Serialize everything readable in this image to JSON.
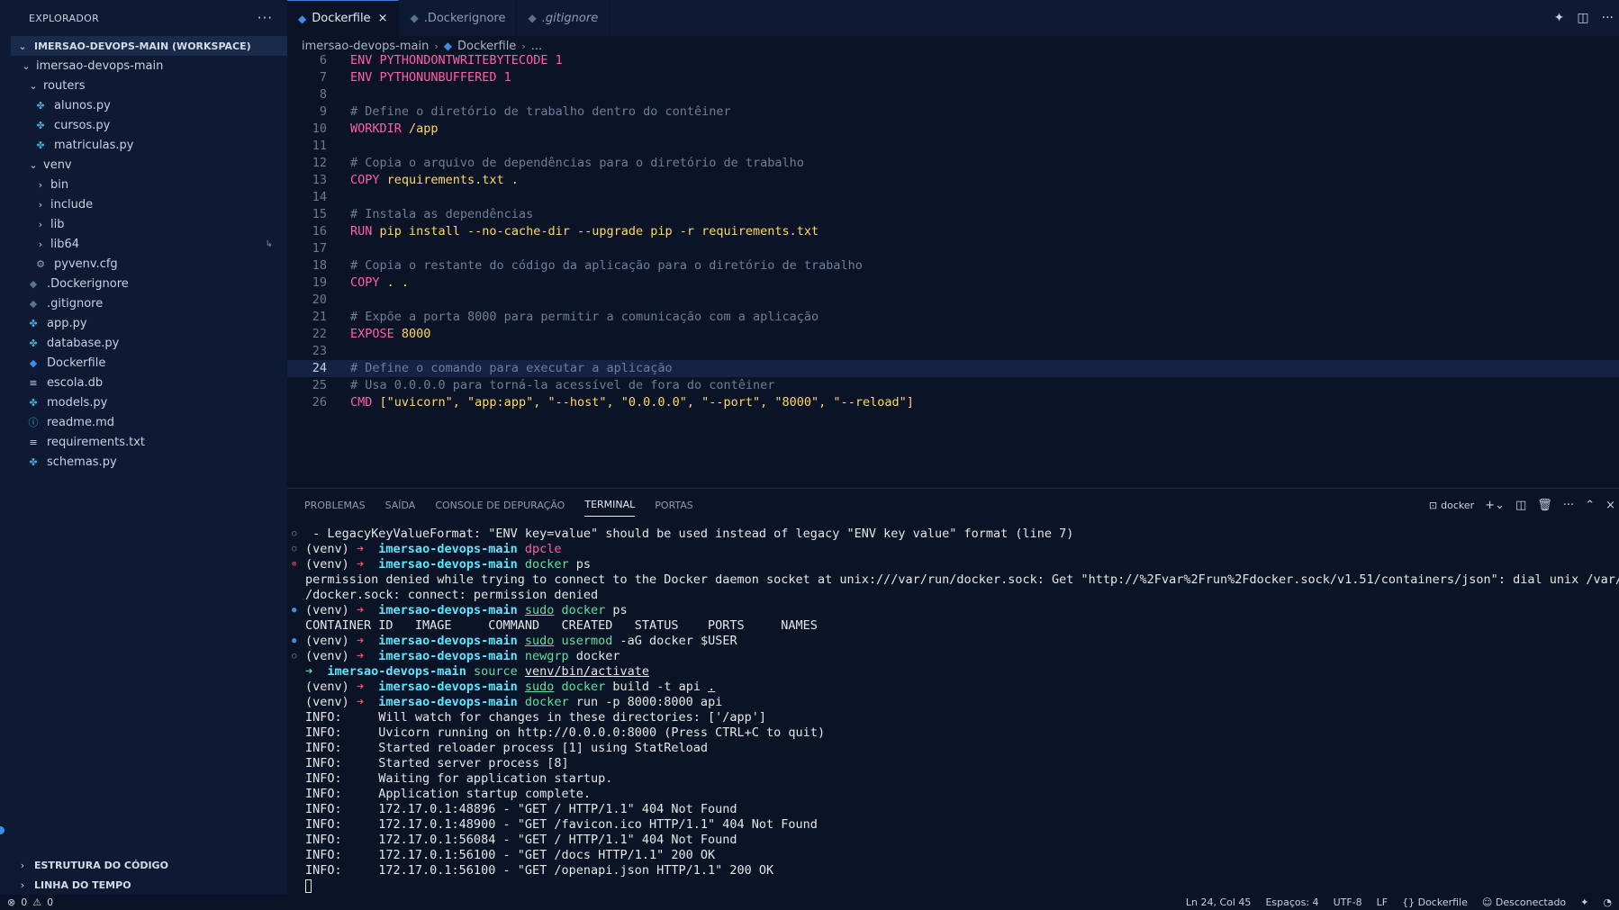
{
  "sidebar": {
    "title": "EXPLORADOR",
    "more": "···",
    "workspace": "IMERSAO-DEVOPS-MAIN (WORKSPACE)",
    "tree": [
      {
        "label": "imersao-devops-main",
        "chev": "⌄",
        "icon": "",
        "indent": 1,
        "color": "#c8d0e0"
      },
      {
        "label": "routers",
        "chev": "⌄",
        "icon": "",
        "indent": 2,
        "color": "#c8d0e0"
      },
      {
        "label": "alunos.py",
        "chev": "",
        "icon": "✤",
        "indent": 3,
        "color": "#4aa8d8"
      },
      {
        "label": "cursos.py",
        "chev": "",
        "icon": "✤",
        "indent": 3,
        "color": "#4aa8d8"
      },
      {
        "label": "matriculas.py",
        "chev": "",
        "icon": "✤",
        "indent": 3,
        "color": "#4aa8d8"
      },
      {
        "label": "venv",
        "chev": "⌄",
        "icon": "",
        "indent": 2,
        "color": "#c8d0e0"
      },
      {
        "label": "bin",
        "chev": "›",
        "icon": "",
        "indent": 3,
        "color": "#c8d0e0"
      },
      {
        "label": "include",
        "chev": "›",
        "icon": "",
        "indent": 3,
        "color": "#c8d0e0"
      },
      {
        "label": "lib",
        "chev": "›",
        "icon": "",
        "indent": 3,
        "color": "#c8d0e0"
      },
      {
        "label": "lib64",
        "chev": "›",
        "icon": "",
        "indent": 3,
        "color": "#c8d0e0",
        "badge": "↳"
      },
      {
        "label": "pyvenv.cfg",
        "chev": "",
        "icon": "⚙",
        "indent": 3,
        "color": "#9aa5b8"
      },
      {
        "label": ".Dockerignore",
        "chev": "",
        "icon": "◆",
        "indent": 2,
        "color": "#5b6f8f"
      },
      {
        "label": ".gitignore",
        "chev": "",
        "icon": "◆",
        "indent": 2,
        "color": "#5b6f8f"
      },
      {
        "label": "app.py",
        "chev": "",
        "icon": "✤",
        "indent": 2,
        "color": "#4aa8d8"
      },
      {
        "label": "database.py",
        "chev": "",
        "icon": "✤",
        "indent": 2,
        "color": "#4aa8d8"
      },
      {
        "label": "Dockerfile",
        "chev": "",
        "icon": "◆",
        "indent": 2,
        "color": "#3a8ee6"
      },
      {
        "label": "escola.db",
        "chev": "",
        "icon": "≡",
        "indent": 2,
        "color": "#c8d0e0"
      },
      {
        "label": "models.py",
        "chev": "",
        "icon": "✤",
        "indent": 2,
        "color": "#4aa8d8"
      },
      {
        "label": "readme.md",
        "chev": "",
        "icon": "ⓘ",
        "indent": 2,
        "color": "#4aa8d8"
      },
      {
        "label": "requirements.txt",
        "chev": "",
        "icon": "≡",
        "indent": 2,
        "color": "#c8d0e0"
      },
      {
        "label": "schemas.py",
        "chev": "",
        "icon": "✤",
        "indent": 2,
        "color": "#4aa8d8"
      }
    ],
    "bottom_sections": [
      "ESTRUTURA DO CÓDIGO",
      "LINHA DO TEMPO"
    ]
  },
  "tabs": [
    {
      "label": "Dockerfile",
      "active": true,
      "italic": false,
      "close": "×"
    },
    {
      "label": ".Dockerignore",
      "active": false,
      "italic": false
    },
    {
      "label": ".gitignore",
      "active": false,
      "italic": true
    }
  ],
  "breadcrumb": {
    "folder": "imersao-devops-main",
    "file": "Dockerfile",
    "rest": "..."
  },
  "code": [
    {
      "n": "6",
      "parts": [
        [
          "kw",
          "ENV PYTHONDONTWRITEBYTECODE 1"
        ]
      ]
    },
    {
      "n": "7",
      "parts": [
        [
          "kw",
          "ENV PYTHONUNBUFFERED 1"
        ]
      ]
    },
    {
      "n": "8",
      "parts": []
    },
    {
      "n": "9",
      "parts": [
        [
          "cm",
          "# Define o diretório de trabalho dentro do contêiner"
        ]
      ]
    },
    {
      "n": "10",
      "parts": [
        [
          "kw",
          "WORKDIR "
        ],
        [
          "str",
          "/app"
        ]
      ]
    },
    {
      "n": "11",
      "parts": []
    },
    {
      "n": "12",
      "parts": [
        [
          "cm",
          "# Copia o arquivo de dependências para o diretório de trabalho"
        ]
      ]
    },
    {
      "n": "13",
      "parts": [
        [
          "kw",
          "COPY "
        ],
        [
          "str",
          "requirements.txt ."
        ]
      ]
    },
    {
      "n": "14",
      "parts": []
    },
    {
      "n": "15",
      "parts": [
        [
          "cm",
          "# Instala as dependências"
        ]
      ]
    },
    {
      "n": "16",
      "parts": [
        [
          "kw",
          "RUN "
        ],
        [
          "str",
          "pip install --no-cache-dir --upgrade pip -r requirements.txt"
        ]
      ]
    },
    {
      "n": "17",
      "parts": []
    },
    {
      "n": "18",
      "parts": [
        [
          "cm",
          "# Copia o restante do código da aplicação para o diretório de trabalho"
        ]
      ]
    },
    {
      "n": "19",
      "parts": [
        [
          "kw",
          "COPY "
        ],
        [
          "str",
          ". ."
        ]
      ]
    },
    {
      "n": "20",
      "parts": []
    },
    {
      "n": "21",
      "parts": [
        [
          "cm",
          "# Expõe a porta 8000 para permitir a comunicação com a aplicação"
        ]
      ]
    },
    {
      "n": "22",
      "parts": [
        [
          "kw",
          "EXPOSE "
        ],
        [
          "str",
          "8000"
        ]
      ]
    },
    {
      "n": "23",
      "parts": []
    },
    {
      "n": "24",
      "parts": [
        [
          "cm",
          "# Define o comando para executar a aplicação"
        ]
      ],
      "current": true
    },
    {
      "n": "25",
      "parts": [
        [
          "cm",
          "# Usa 0.0.0.0 para torná-la acessível de fora do contêiner"
        ]
      ]
    },
    {
      "n": "26",
      "parts": [
        [
          "kw",
          "CMD "
        ],
        [
          "str",
          "[\"uvicorn\", \"app:app\", \"--host\", \"0.0.0.0\", \"--port\", \"8000\", \"--reload\"]"
        ]
      ]
    }
  ],
  "panel": {
    "tabs": [
      {
        "label": "PROBLEMAS",
        "active": false
      },
      {
        "label": "SAÍDA",
        "active": false
      },
      {
        "label": "CONSOLE DE DEPURAÇÃO",
        "active": false
      },
      {
        "label": "TERMINAL",
        "active": true
      },
      {
        "label": "PORTAS",
        "active": false
      }
    ],
    "terminal_name": "docker"
  },
  "terminal": [
    {
      "mark": "neutral",
      "sym": "○",
      "parts": [
        [
          "plain",
          " - LegacyKeyValueFormat: \"ENV key=value\" should be used instead of legacy \"ENV key value\" format (line 7)"
        ]
      ]
    },
    {
      "mark": "neutral",
      "sym": "○",
      "parts": [
        [
          "plain",
          "(venv) "
        ],
        [
          "arrow",
          "➜  "
        ],
        [
          "dir",
          "imersao-devops-main "
        ],
        [
          "mag",
          "dpcle"
        ]
      ]
    },
    {
      "mark": "err",
      "sym": "⊗",
      "parts": [
        [
          "plain",
          "(venv) "
        ],
        [
          "arrow",
          "➜  "
        ],
        [
          "dir",
          "imersao-devops-main "
        ],
        [
          "cmd",
          "docker "
        ],
        [
          "plain",
          "ps"
        ]
      ]
    },
    {
      "mark": "",
      "sym": "",
      "parts": [
        [
          "plain",
          "permission denied while trying to connect to the Docker daemon socket at unix:///var/run/docker.sock: Get \"http://%2Fvar%2Frun%2Fdocker.sock/v1.51/containers/json\": dial unix /var/run"
        ]
      ]
    },
    {
      "mark": "",
      "sym": "",
      "parts": [
        [
          "plain",
          "/docker.sock: connect: permission denied"
        ]
      ]
    },
    {
      "mark": "ok",
      "sym": "●",
      "parts": [
        [
          "plain",
          "(venv) "
        ],
        [
          "arrow",
          "➜  "
        ],
        [
          "dir",
          "imersao-devops-main "
        ],
        [
          "cmd ul",
          "sudo"
        ],
        [
          "plain",
          " "
        ],
        [
          "cmd",
          "docker "
        ],
        [
          "plain",
          "ps"
        ]
      ]
    },
    {
      "mark": "",
      "sym": "",
      "parts": [
        [
          "plain",
          "CONTAINER ID   IMAGE     COMMAND   CREATED   STATUS    PORTS     NAMES"
        ]
      ]
    },
    {
      "mark": "ok",
      "sym": "●",
      "parts": [
        [
          "plain",
          "(venv) "
        ],
        [
          "arrow",
          "➜  "
        ],
        [
          "dir",
          "imersao-devops-main "
        ],
        [
          "cmd ul",
          "sudo"
        ],
        [
          "plain",
          " "
        ],
        [
          "cmd",
          "usermod "
        ],
        [
          "plain",
          "-aG docker $USER"
        ]
      ]
    },
    {
      "mark": "neutral",
      "sym": "○",
      "parts": [
        [
          "plain",
          "(venv) "
        ],
        [
          "arrow",
          "➜  "
        ],
        [
          "dir",
          "imersao-devops-main "
        ],
        [
          "cmd",
          "newgrp "
        ],
        [
          "plain",
          "docker"
        ]
      ]
    },
    {
      "mark": "",
      "sym": "",
      "parts": [
        [
          "arrow-g",
          "➜  "
        ],
        [
          "dir",
          "imersao-devops-main "
        ],
        [
          "cmd",
          "source "
        ],
        [
          "plain ul",
          "venv/bin/activate"
        ]
      ]
    },
    {
      "mark": "",
      "sym": "",
      "parts": [
        [
          "plain",
          "(venv) "
        ],
        [
          "arrow",
          "➜  "
        ],
        [
          "dir",
          "imersao-devops-main "
        ],
        [
          "cmd ul",
          "sudo"
        ],
        [
          "plain",
          " "
        ],
        [
          "cmd",
          "docker "
        ],
        [
          "plain",
          "build -t api "
        ],
        [
          "plain ul",
          "."
        ]
      ]
    },
    {
      "mark": "",
      "sym": "",
      "parts": [
        [
          "plain",
          "(venv) "
        ],
        [
          "arrow",
          "➜  "
        ],
        [
          "dir",
          "imersao-devops-main "
        ],
        [
          "cmd",
          "docker "
        ],
        [
          "plain",
          "run -p 8000:8000 api"
        ]
      ]
    },
    {
      "mark": "",
      "sym": "",
      "parts": [
        [
          "plain",
          "INFO:     Will watch for changes in these directories: ['/app']"
        ]
      ]
    },
    {
      "mark": "",
      "sym": "",
      "parts": [
        [
          "plain",
          "INFO:     Uvicorn running on http://0.0.0.0:8000 (Press CTRL+C to quit)"
        ]
      ]
    },
    {
      "mark": "",
      "sym": "",
      "parts": [
        [
          "plain",
          "INFO:     Started reloader process [1] using StatReload"
        ]
      ]
    },
    {
      "mark": "",
      "sym": "",
      "parts": [
        [
          "plain",
          "INFO:     Started server process [8]"
        ]
      ]
    },
    {
      "mark": "",
      "sym": "",
      "parts": [
        [
          "plain",
          "INFO:     Waiting for application startup."
        ]
      ]
    },
    {
      "mark": "",
      "sym": "",
      "parts": [
        [
          "plain",
          "INFO:     Application startup complete."
        ]
      ]
    },
    {
      "mark": "",
      "sym": "",
      "parts": [
        [
          "plain",
          "INFO:     172.17.0.1:48896 - \"GET / HTTP/1.1\" 404 Not Found"
        ]
      ]
    },
    {
      "mark": "",
      "sym": "",
      "parts": [
        [
          "plain",
          "INFO:     172.17.0.1:48900 - \"GET /favicon.ico HTTP/1.1\" 404 Not Found"
        ]
      ]
    },
    {
      "mark": "",
      "sym": "",
      "parts": [
        [
          "plain",
          "INFO:     172.17.0.1:56084 - \"GET / HTTP/1.1\" 404 Not Found"
        ]
      ]
    },
    {
      "mark": "",
      "sym": "",
      "parts": [
        [
          "plain",
          "INFO:     172.17.0.1:56100 - \"GET /docs HTTP/1.1\" 200 OK"
        ]
      ]
    },
    {
      "mark": "",
      "sym": "",
      "parts": [
        [
          "plain",
          "INFO:     172.17.0.1:56100 - \"GET /openapi.json HTTP/1.1\" 200 OK"
        ]
      ]
    }
  ],
  "status": {
    "errors": "0",
    "warnings": "0",
    "position": "Ln 24, Col 45",
    "spaces": "Espaços: 4",
    "encoding": "UTF-8",
    "eol": "LF",
    "language": "Dockerfile",
    "connection": "Desconectado"
  }
}
